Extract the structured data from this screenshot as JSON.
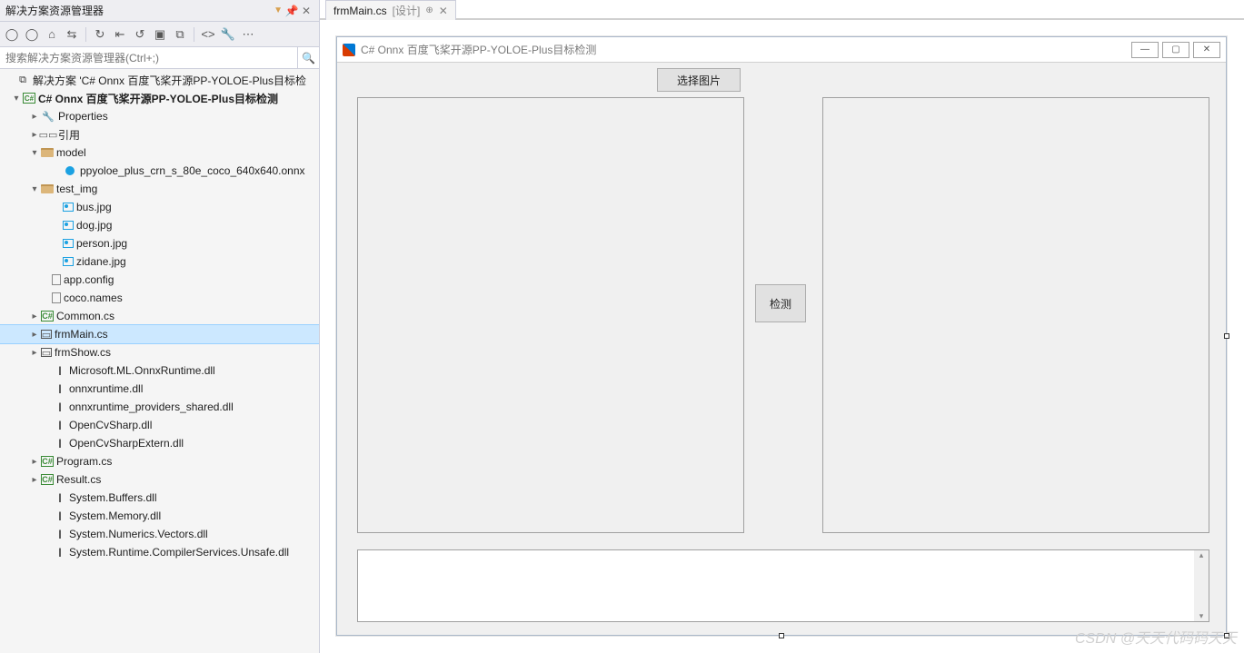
{
  "panel": {
    "title": "解决方案资源管理器",
    "search_placeholder": "搜索解决方案资源管理器(Ctrl+;)"
  },
  "tree": {
    "solution": "解决方案 'C# Onnx 百度飞桨开源PP-YOLOE-Plus目标检",
    "project": "C# Onnx 百度飞桨开源PP-YOLOE-Plus目标检测",
    "properties": "Properties",
    "references": "引用",
    "folder_model": "model",
    "file_onnx": "ppyoloe_plus_crn_s_80e_coco_640x640.onnx",
    "folder_test": "test_img",
    "img_bus": "bus.jpg",
    "img_dog": "dog.jpg",
    "img_person": "person.jpg",
    "img_zidane": "zidane.jpg",
    "app_config": "app.config",
    "coco_names": "coco.names",
    "common_cs": "Common.cs",
    "frmmain_cs": "frmMain.cs",
    "frmshow_cs": "frmShow.cs",
    "dll_msml": "Microsoft.ML.OnnxRuntime.dll",
    "dll_onnx": "onnxruntime.dll",
    "dll_onnx_prov": "onnxruntime_providers_shared.dll",
    "dll_cvsharp": "OpenCvSharp.dll",
    "dll_cvsharp_ext": "OpenCvSharpExtern.dll",
    "program_cs": "Program.cs",
    "result_cs": "Result.cs",
    "dll_buffers": "System.Buffers.dll",
    "dll_memory": "System.Memory.dll",
    "dll_numerics": "System.Numerics.Vectors.dll",
    "dll_compiler": "System.Runtime.CompilerServices.Unsafe.dll"
  },
  "tab": {
    "name": "frmMain.cs",
    "suffix": "[设计]"
  },
  "form": {
    "title": "C# Onnx 百度飞桨开源PP-YOLOE-Plus目标检测",
    "btn_select": "选择图片",
    "btn_detect": "检测"
  },
  "watermark": "CSDN @天天代码码天天"
}
